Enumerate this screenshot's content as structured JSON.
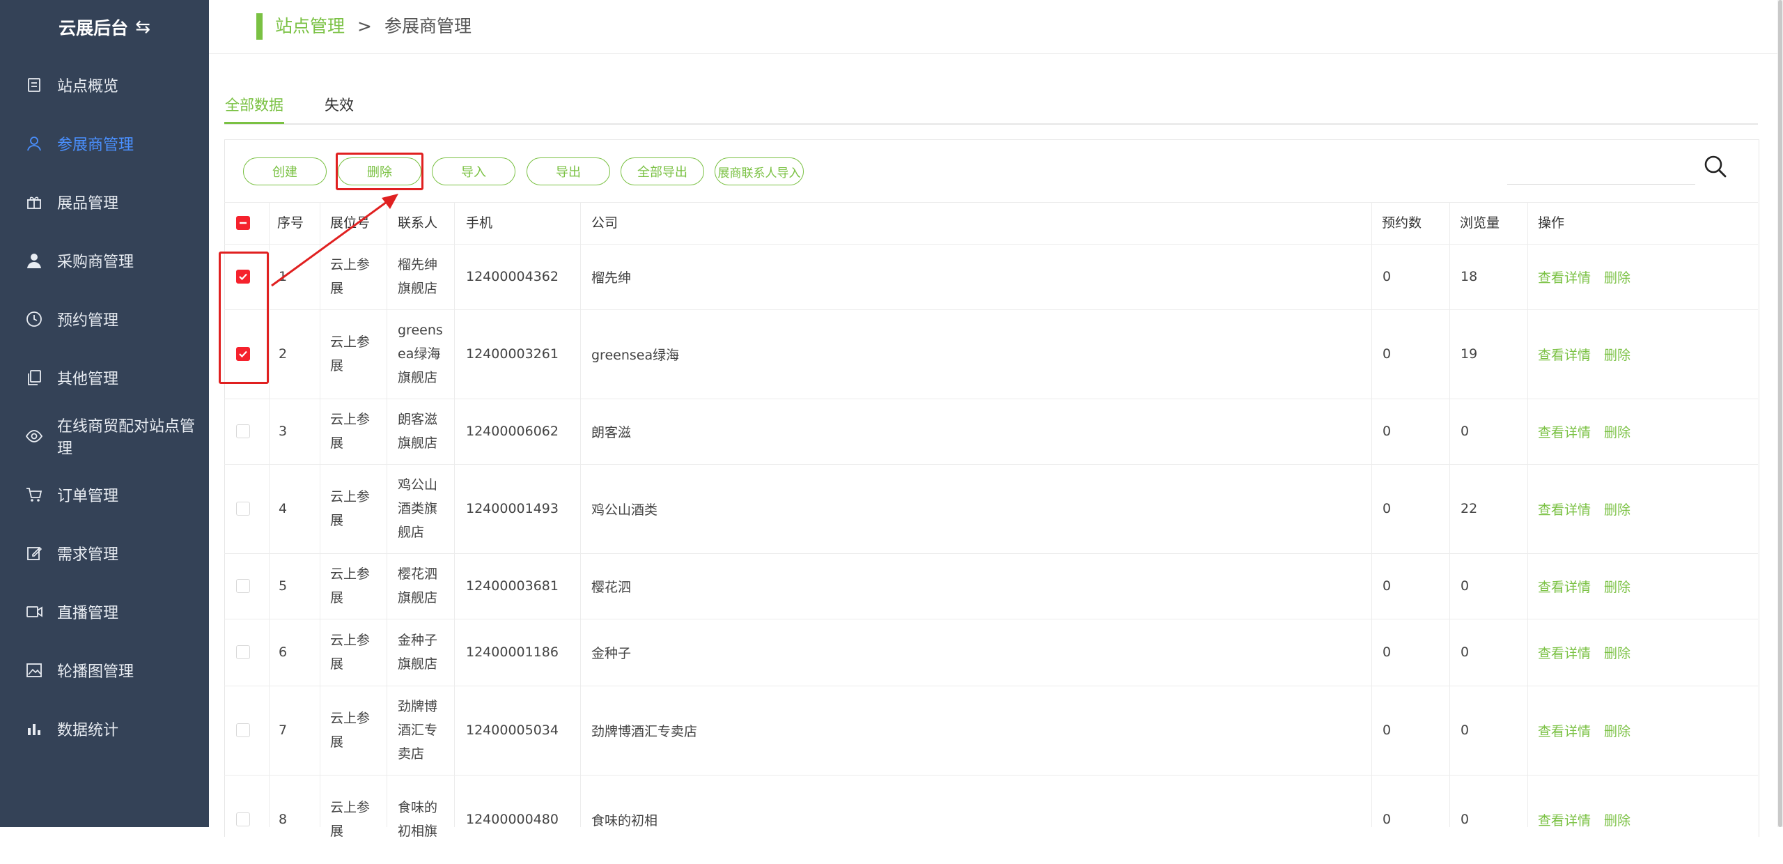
{
  "app": {
    "title": "云展后台"
  },
  "sidebar": {
    "items": [
      {
        "label": "站点概览",
        "icon": "overview-icon",
        "active": false
      },
      {
        "label": "参展商管理",
        "icon": "user-icon",
        "active": true
      },
      {
        "label": "展品管理",
        "icon": "gift-icon",
        "active": false
      },
      {
        "label": "采购商管理",
        "icon": "person-icon",
        "active": false
      },
      {
        "label": "预约管理",
        "icon": "clock-icon",
        "active": false
      },
      {
        "label": "其他管理",
        "icon": "copy-icon",
        "active": false
      },
      {
        "label": "在线商贸配对站点管理",
        "icon": "eye-icon",
        "active": false
      },
      {
        "label": "订单管理",
        "icon": "cart-icon",
        "active": false
      },
      {
        "label": "需求管理",
        "icon": "edit-icon",
        "active": false
      },
      {
        "label": "直播管理",
        "icon": "video-icon",
        "active": false
      },
      {
        "label": "轮播图管理",
        "icon": "image-icon",
        "active": false
      },
      {
        "label": "数据统计",
        "icon": "bar-chart-icon",
        "active": false
      }
    ]
  },
  "breadcrumb": {
    "parent": "站点管理",
    "separator": ">",
    "current": "参展商管理"
  },
  "tabs": [
    {
      "label": "全部数据",
      "active": true
    },
    {
      "label": "失效",
      "active": false
    }
  ],
  "toolbar": {
    "create": "创建",
    "delete": "删除",
    "import": "导入",
    "export": "导出",
    "export_all": "全部导出",
    "import_contacts": "展商联系人导入"
  },
  "table": {
    "headers": {
      "index": "序号",
      "booth": "展位号",
      "contact": "联系人",
      "phone": "手机",
      "company": "公司",
      "appointments": "预约数",
      "views": "浏览量",
      "actions": "操作"
    },
    "rows": [
      {
        "index": "1",
        "booth": [
          "云上参",
          "展"
        ],
        "contact": [
          "榴先绅",
          "旗舰店"
        ],
        "phone": "12400004362",
        "company": "榴先绅",
        "appointments": "0",
        "views": "18",
        "checked": true
      },
      {
        "index": "2",
        "booth": [
          "云上参",
          "展"
        ],
        "contact": [
          "greens",
          "ea绿海",
          "旗舰店"
        ],
        "phone": "12400003261",
        "company": "greensea绿海",
        "appointments": "0",
        "views": "19",
        "checked": true
      },
      {
        "index": "3",
        "booth": [
          "云上参",
          "展"
        ],
        "contact": [
          "朗客滋",
          "旗舰店"
        ],
        "phone": "12400006062",
        "company": "朗客滋",
        "appointments": "0",
        "views": "0",
        "checked": false
      },
      {
        "index": "4",
        "booth": [
          "云上参",
          "展"
        ],
        "contact": [
          "鸡公山",
          "酒类旗",
          "舰店"
        ],
        "phone": "12400001493",
        "company": "鸡公山酒类",
        "appointments": "0",
        "views": "22",
        "checked": false
      },
      {
        "index": "5",
        "booth": [
          "云上参",
          "展"
        ],
        "contact": [
          "樱花泗",
          "旗舰店"
        ],
        "phone": "12400003681",
        "company": "樱花泗",
        "appointments": "0",
        "views": "0",
        "checked": false
      },
      {
        "index": "6",
        "booth": [
          "云上参",
          "展"
        ],
        "contact": [
          "金种子",
          "旗舰店"
        ],
        "phone": "12400001186",
        "company": "金种子",
        "appointments": "0",
        "views": "0",
        "checked": false
      },
      {
        "index": "7",
        "booth": [
          "云上参",
          "展"
        ],
        "contact": [
          "劲牌博",
          "酒汇专",
          "卖店"
        ],
        "phone": "12400005034",
        "company": "劲牌博酒汇专卖店",
        "appointments": "0",
        "views": "0",
        "checked": false
      },
      {
        "index": "8",
        "booth": [
          "云上参",
          "展"
        ],
        "contact": [
          "食味的",
          "初相旗"
        ],
        "phone": "12400000480",
        "company": "食味的初相",
        "appointments": "0",
        "views": "0",
        "checked": false
      }
    ],
    "action_view": "查看详情",
    "action_delete": "删除"
  },
  "colors": {
    "sidebar_bg": "#344257",
    "accent_green": "#7ac143",
    "active_blue": "#4a90ff",
    "checkbox_red": "#f5222d",
    "annotation_red": "#e02020"
  }
}
